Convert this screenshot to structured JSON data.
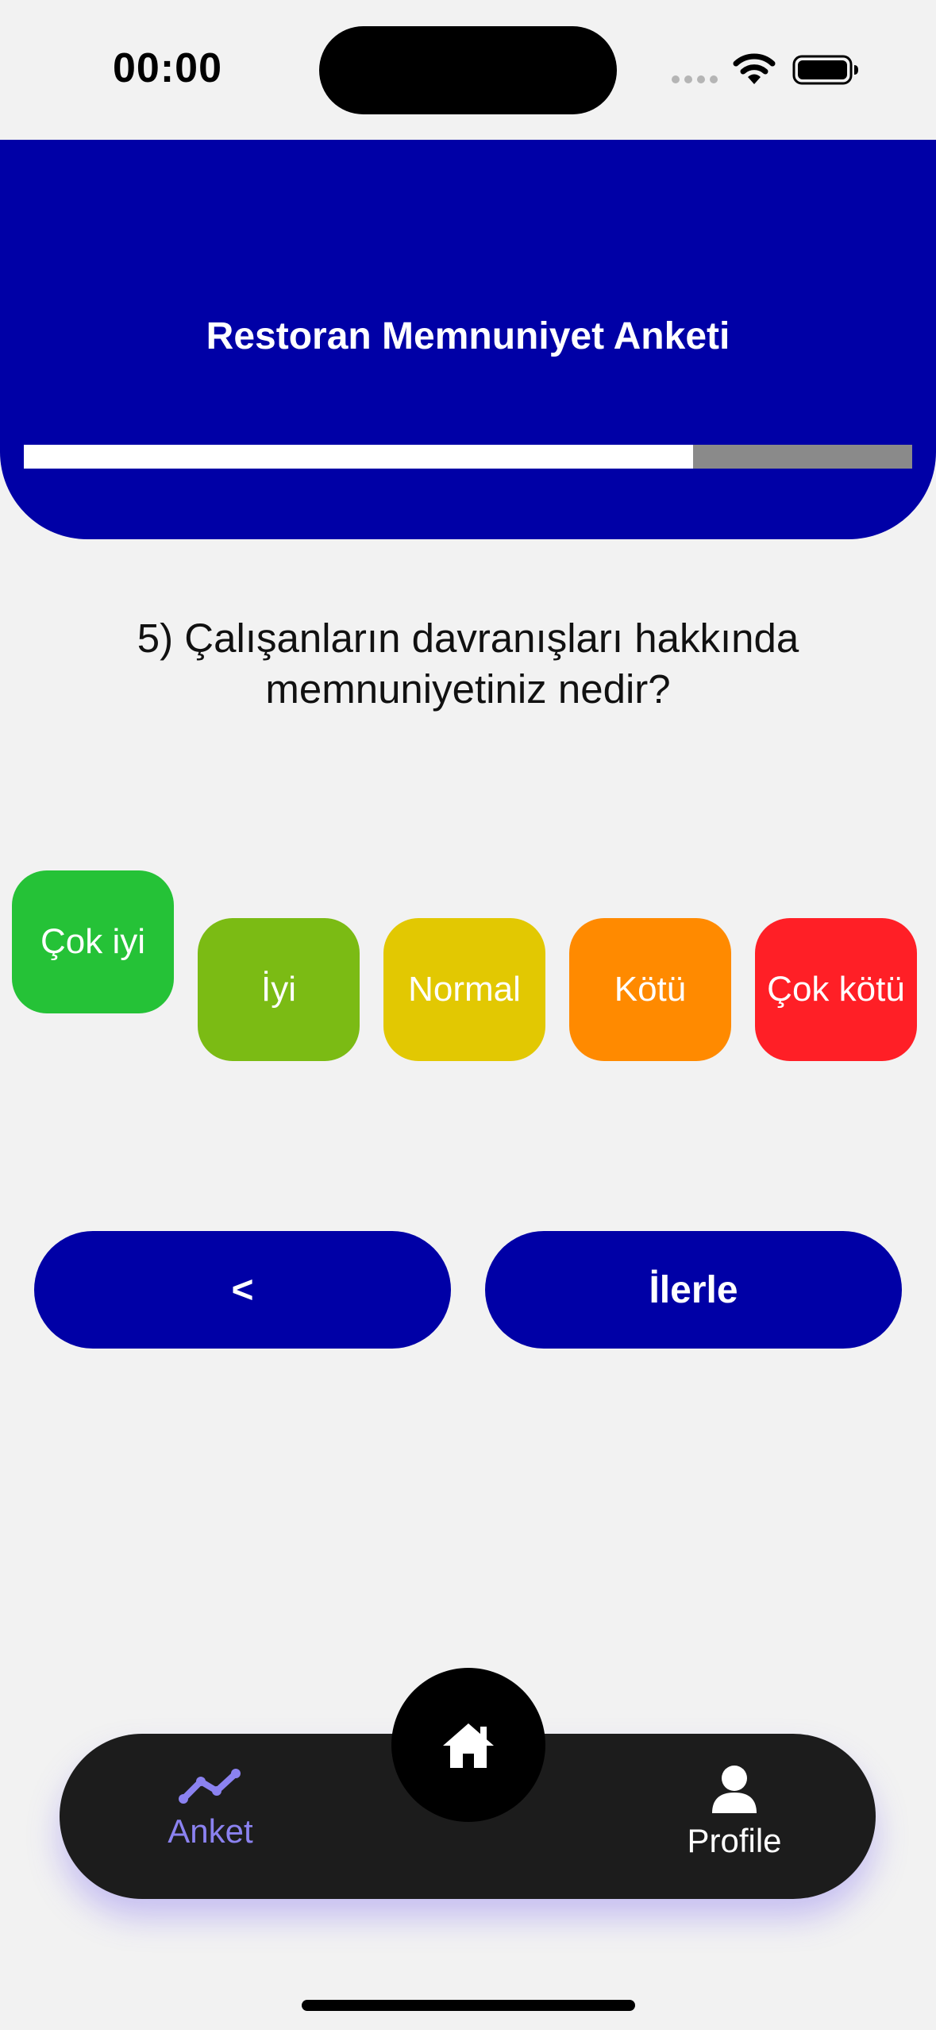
{
  "status_bar": {
    "time": "00:00"
  },
  "header": {
    "title": "Restoran Memnuniyet Anketi",
    "progress": 0.753,
    "background": "#0000a6"
  },
  "question": {
    "text": "5) Çalışanların davranışları hakkında memnuniyetiniz nedir?"
  },
  "options": [
    {
      "label": "Çok iyi",
      "color": "#25c237",
      "selected": true
    },
    {
      "label": "İyi",
      "color": "#7bbb14",
      "selected": false
    },
    {
      "label": "Normal",
      "color": "#e2c802",
      "selected": false
    },
    {
      "label": "Kötü",
      "color": "#ff8a00",
      "selected": false
    },
    {
      "label": "Çok kötü",
      "color": "#ff1f26",
      "selected": false
    }
  ],
  "navigation": {
    "back_label": "<",
    "next_label": "İlerle"
  },
  "tab_bar": {
    "anket_label": "Anket",
    "anket_icon": "chart-line-icon",
    "home_icon": "home-icon",
    "profile_label": "Profile",
    "profile_icon": "person-icon",
    "active_color": "#8b82f0"
  }
}
